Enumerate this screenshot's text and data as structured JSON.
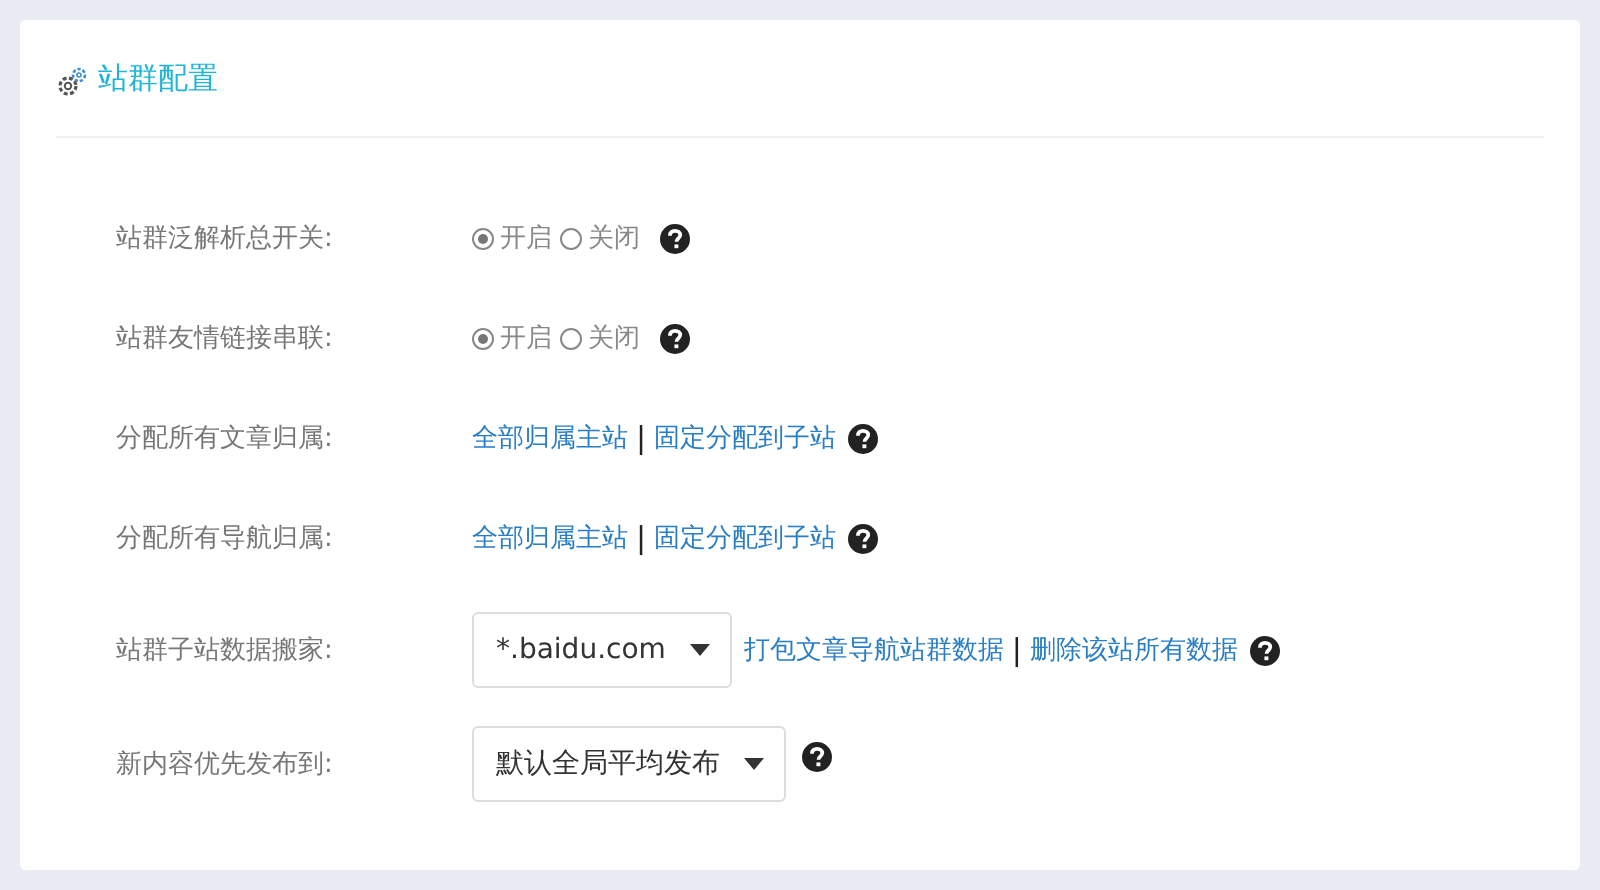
{
  "panel": {
    "title": "站群配置"
  },
  "rows": [
    {
      "kind": "radio",
      "label": "站群泛解析总开关:",
      "options": [
        {
          "label": "开启",
          "selected": true
        },
        {
          "label": "关闭",
          "selected": false
        }
      ]
    },
    {
      "kind": "radio",
      "label": "站群友情链接串联:",
      "options": [
        {
          "label": "开启",
          "selected": true
        },
        {
          "label": "关闭",
          "selected": false
        }
      ]
    },
    {
      "kind": "links",
      "label": "分配所有文章归属:",
      "links": [
        "全部归属主站",
        "固定分配到子站"
      ],
      "separator": "|"
    },
    {
      "kind": "links",
      "label": "分配所有导航归属:",
      "links": [
        "全部归属主站",
        "固定分配到子站"
      ],
      "separator": "|"
    },
    {
      "kind": "select_links",
      "label": "站群子站数据搬家:",
      "select": "*.baidu.com",
      "links": [
        "打包文章导航站群数据",
        "删除该站所有数据"
      ],
      "separator": "|"
    },
    {
      "kind": "select",
      "label": "新内容优先发布到:",
      "select": "默认全局平均发布"
    }
  ]
}
